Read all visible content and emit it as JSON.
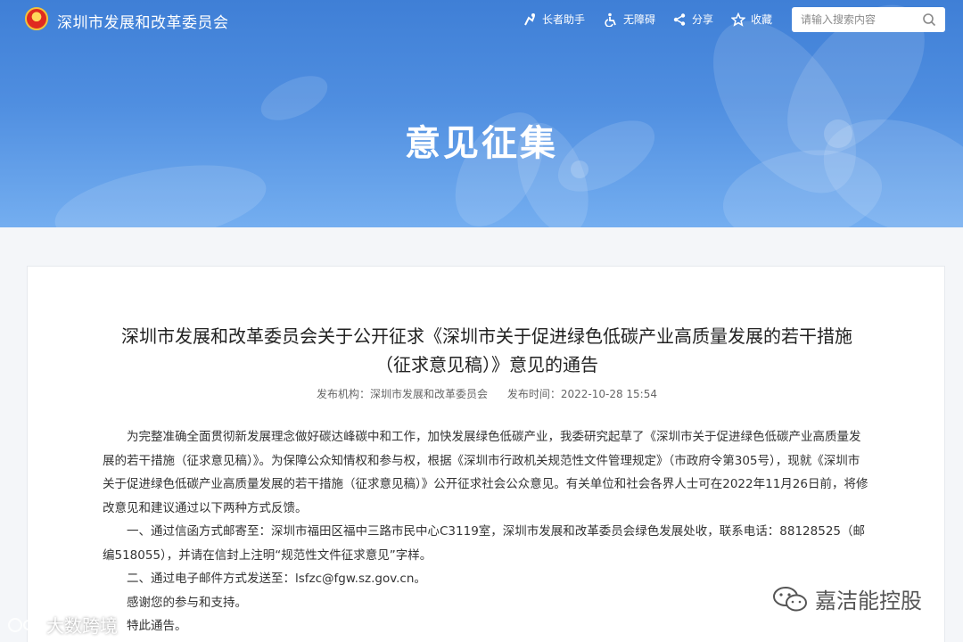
{
  "header": {
    "site_title": "深圳市发展和改革委员会",
    "tools": [
      {
        "label": "长者助手",
        "icon": "elder-helper-icon"
      },
      {
        "label": "无障碍",
        "icon": "accessibility-icon"
      },
      {
        "label": "分享",
        "icon": "share-icon"
      },
      {
        "label": "收藏",
        "icon": "star-icon"
      }
    ],
    "search": {
      "placeholder": "请输入搜索内容",
      "value": ""
    }
  },
  "banner": {
    "title": "意见征集"
  },
  "article": {
    "title_line1": "深圳市发展和改革委员会关于公开征求《深圳市关于促进绿色低碳产业高质量发展的若干措施",
    "title_line2": "（征求意见稿）》意见的通告",
    "publisher": "发布机构：深圳市发展和改革委员会",
    "publish_time": "发布时间：2022-10-28 15:54",
    "paragraphs": [
      "为完整准确全面贯彻新发展理念做好碳达峰碳中和工作，加快发展绿色低碳产业，我委研究起草了《深圳市关于促进绿色低碳产业高质量发展的若干措施（征求意见稿）》。为保障公众知情权和参与权，根据《深圳市行政机关规范性文件管理规定》（市政府令第305号），现就《深圳市关于促进绿色低碳产业高质量发展的若干措施（征求意见稿）》公开征求社会公众意见。有关单位和社会各界人士可在2022年11月26日前，将修改意见和建议通过以下两种方式反馈。",
      "一、通过信函方式邮寄至：深圳市福田区福中三路市民中心C3119室，深圳市发展和改革委员会绿色发展处收，联系电话：88128525（邮编518055），并请在信封上注明“规范性文件征求意见”字样。",
      "二、通过电子邮件方式发送至：lsfzc@fgw.sz.gov.cn。",
      "感谢您的参与和支持。",
      "特此通告。"
    ]
  },
  "watermarks": {
    "left": "大数跨境",
    "right": "嘉洁能控股"
  }
}
